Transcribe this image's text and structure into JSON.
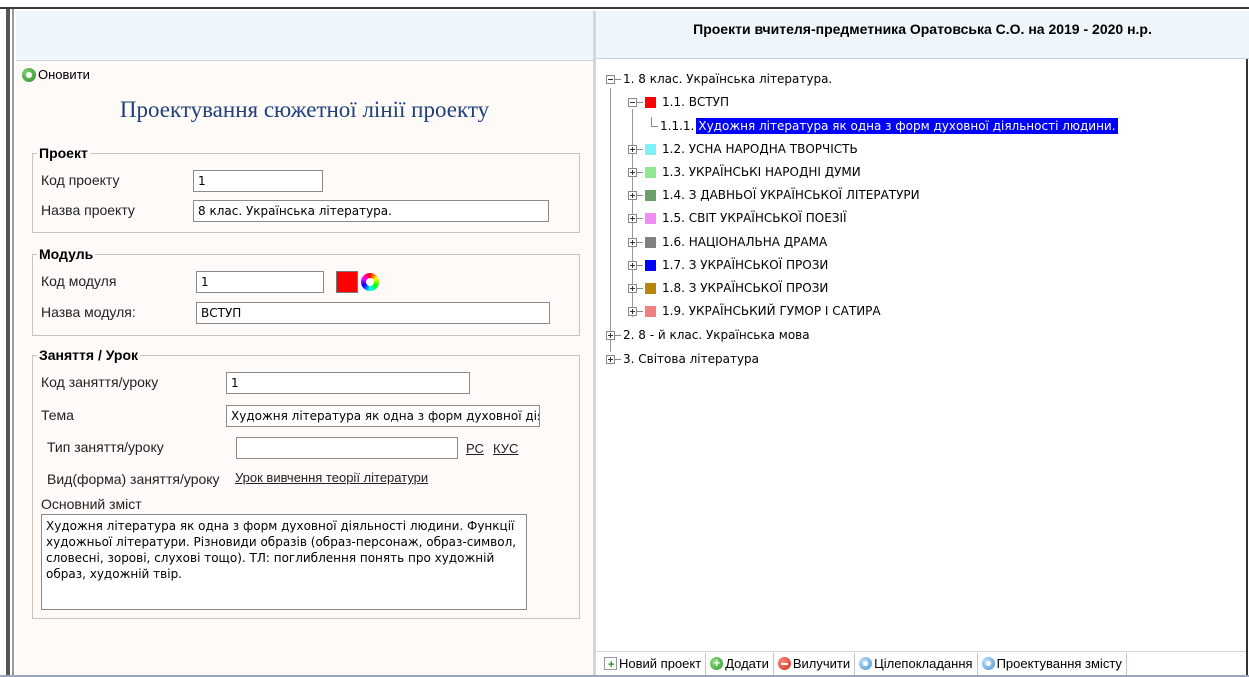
{
  "left": {
    "refresh_label": "Оновити",
    "title": "Проектування сюжетної лінії проекту",
    "project": {
      "legend": "Проект",
      "code_label": "Код проекту",
      "code_value": "1",
      "name_label": "Назва проекту",
      "name_value": "8 клас. Українська література."
    },
    "module": {
      "legend": "Модуль",
      "code_label": "Код модуля",
      "code_value": "1",
      "color": "#ff0000",
      "name_label": "Назва модуля:",
      "name_value": "ВСТУП"
    },
    "lesson": {
      "legend": "Заняття / Урок",
      "code_label": "Код заняття/уроку",
      "code_value": "1",
      "topic_label": "Тема",
      "topic_value": "Художня література як одна з форм духовної діяльності людини.",
      "type_label": "Тип заняття/уроку",
      "type_value": "",
      "link_rs": "РС",
      "link_kus": "КУС",
      "form_label": "Вид(форма) заняття/уроку",
      "form_link": "Урок вивчення теорії літератури",
      "content_label": "Основний зміст",
      "content_lines": [
        "Художня література як одна з форм духовної діяльності людини. Функції",
        "художньої літератури. Різновиди образів (образ-персонаж, образ-символ,",
        "словесні, зорові, слухові тощо). ТЛ: поглиблення понять про художній",
        "образ, художній твір."
      ]
    }
  },
  "right": {
    "title": "Проекти вчителя-предметника Оратовська С.О. на 2019 - 2020 н.р.",
    "tree": {
      "root1": "1. 8 клас. Українська література.",
      "module_1_1": "1.1. ВСТУП",
      "lesson_1_1_1_num": "1.1.1.",
      "lesson_1_1_1_text": "Художня література як одна з форм духовної діяльності людини.",
      "modules": [
        {
          "label": "1.2. УСНА НАРОДНА ТВОРЧІСТЬ",
          "color": "#80f0f8"
        },
        {
          "label": "1.3. УКРАЇНСЬКІ НАРОДНІ ДУМИ",
          "color": "#8ee88e"
        },
        {
          "label": "1.4. З ДАВНЬОЇ УКРАЇНСЬКОЇ ЛІТЕРАТУРИ",
          "color": "#6aa06a"
        },
        {
          "label": "1.5. СВІТ УКРАЇНСЬКОЇ ПОЕЗІЇ",
          "color": "#f28cf0"
        },
        {
          "label": "1.6. НАЦІОНАЛЬНА ДРАМА",
          "color": "#808080"
        },
        {
          "label": "1.7. З УКРАЇНСЬКОЇ ПРОЗИ",
          "color": "#0000ff"
        },
        {
          "label": "1.8. З УКРАЇНСЬКОЇ ПРОЗИ",
          "color": "#b8860b"
        },
        {
          "label": "1.9. УКРАЇНСЬКИЙ ГУМОР І САТИРА",
          "color": "#f08080"
        }
      ],
      "root2": "2. 8 - й клас. Українська мова",
      "root3": "3. Світова література"
    },
    "toolbar": {
      "new_project": "Новий проект",
      "add": "Додати",
      "remove": "Вилучити",
      "goals": "Цілепокладання",
      "content_design": "Проектування змісту"
    }
  }
}
